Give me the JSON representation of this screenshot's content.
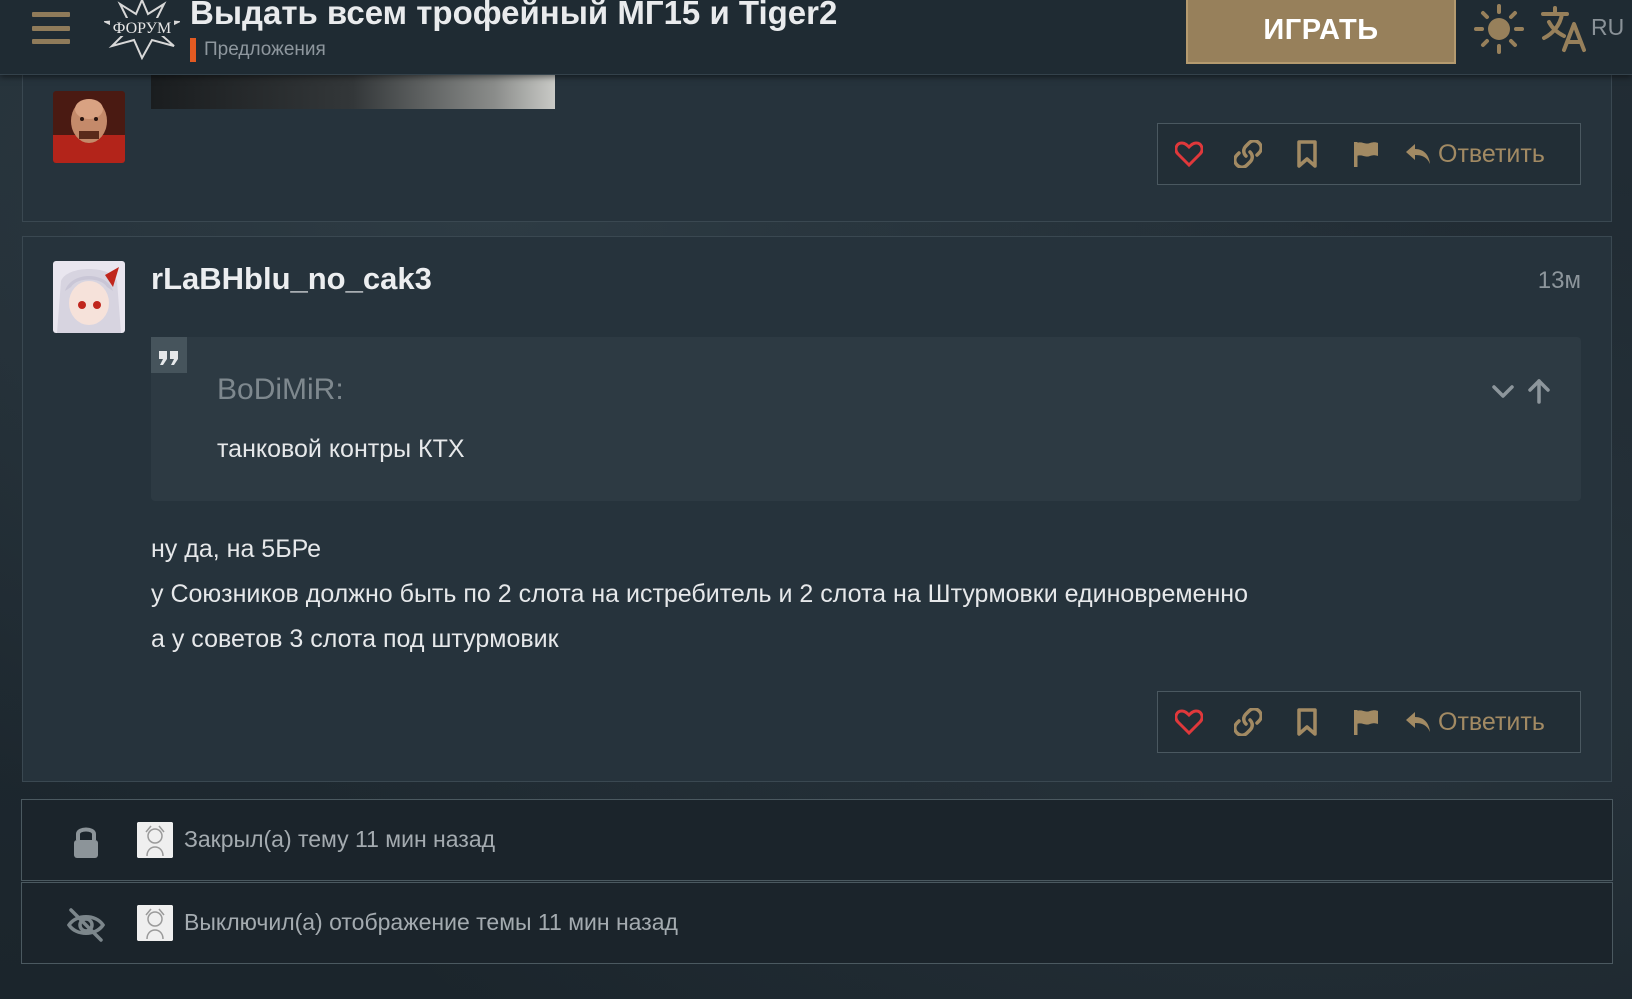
{
  "header": {
    "logo_text": "ФОРУМ",
    "title": "Выдать всем трофейный МГ15 и Tiger2",
    "category": "Предложения",
    "play_label": "ИГРАТЬ",
    "lang": "RU",
    "accent": "#97805b",
    "category_color": "#e25a22"
  },
  "posts": [
    {
      "actions": {
        "reply_label": "Ответить"
      }
    },
    {
      "username": "rLaBHblu_no_cak3",
      "time": "13м",
      "quote": {
        "author": "BoDiMiR:",
        "text": "танковой контры КТХ"
      },
      "body_lines": [
        "ну да, на 5БРе",
        "у Союзников должно быть по 2 слота на истребитель и 2 слота на Штурмовки единовременно",
        "а у советов 3 слота под штурмовик"
      ],
      "actions": {
        "reply_label": "Ответить"
      }
    }
  ],
  "events": [
    {
      "icon": "lock-icon",
      "text": "Закрыл(а) тему 11 мин назад"
    },
    {
      "icon": "eye-off-icon",
      "text": "Выключил(а) отображение темы 11 мин назад"
    }
  ]
}
